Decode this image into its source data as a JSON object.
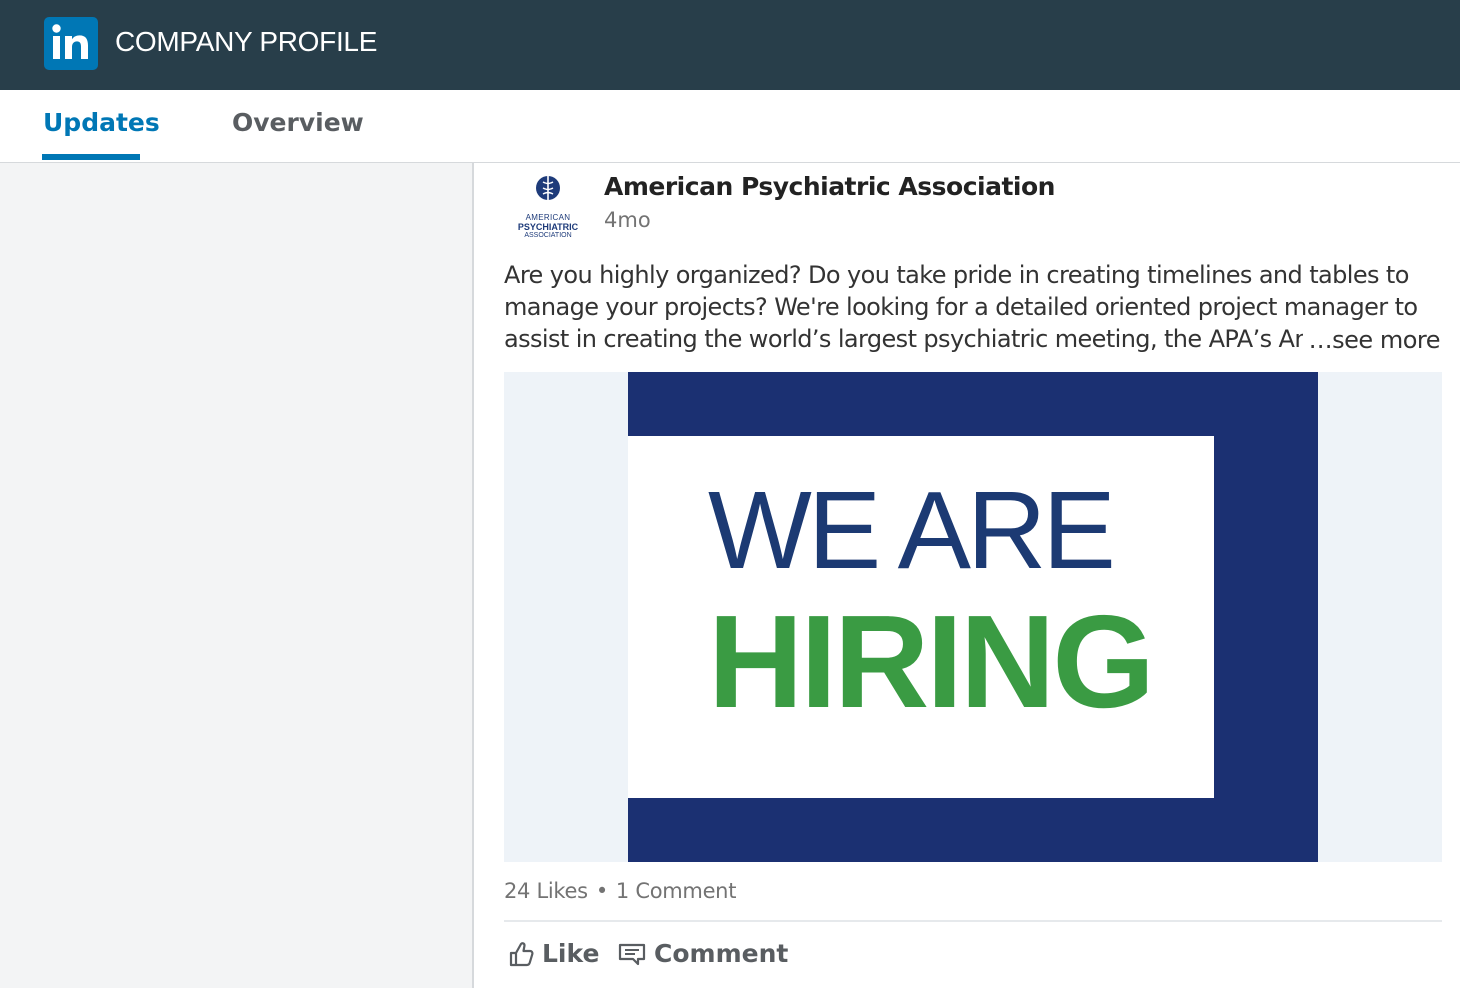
{
  "header": {
    "logo_text": "in",
    "title": "COMPANY PROFILE"
  },
  "tabs": [
    {
      "label": "Updates",
      "active": true
    },
    {
      "label": "Overview",
      "active": false
    }
  ],
  "post": {
    "org_logo_lines": [
      "AMERICAN",
      "PSYCHIATRIC",
      "ASSOCIATION"
    ],
    "org_name": "American Psychiatric Association",
    "time": "4mo",
    "body_lines": [
      "Are you highly organized? Do you take pride in creating timelines and tables to",
      "manage your projects? We're looking for a detailed oriented project manager to",
      "assist in creating the world’s largest psychiatric meeting, the APA’s Ann"
    ],
    "see_more": "…see more",
    "image": {
      "line1": "WE ARE",
      "line2": "HIRING"
    },
    "likes": "24 Likes",
    "separator": "•",
    "comments": "1 Comment",
    "actions": {
      "like": "Like",
      "comment": "Comment"
    }
  },
  "colors": {
    "topbar": "#283e4a",
    "brand": "#0077b5",
    "image_navy": "#1b3072",
    "hiring_green": "#3a9b43"
  },
  "icons": [
    "linkedin-logo-icon",
    "apa-globe-icon",
    "thumbs-up-icon",
    "comment-icon"
  ]
}
